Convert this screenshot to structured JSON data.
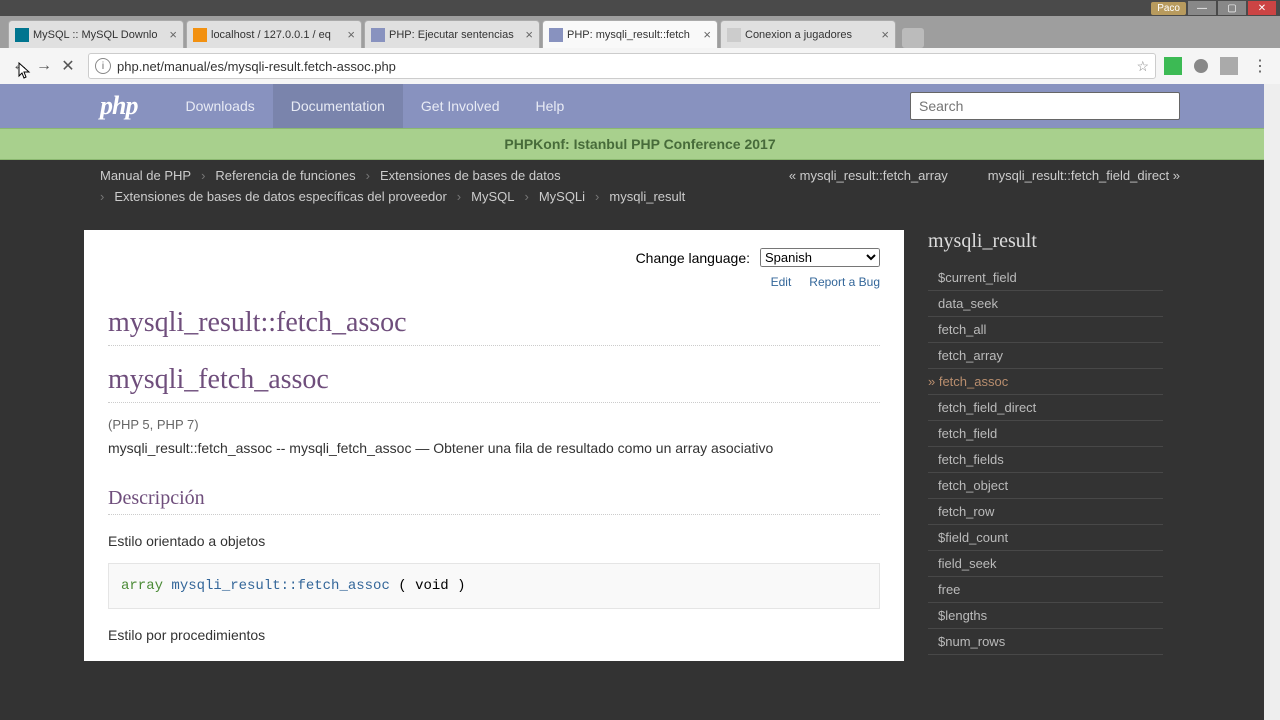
{
  "browser": {
    "user": "Paco",
    "url": "php.net/manual/es/mysqli-result.fetch-assoc.php",
    "tabs": [
      {
        "label": "MySQL :: MySQL Downlo"
      },
      {
        "label": "localhost / 127.0.0.1 / eq"
      },
      {
        "label": "PHP: Ejecutar sentencias"
      },
      {
        "label": "PHP: mysqli_result::fetch"
      },
      {
        "label": "Conexion a jugadores"
      }
    ]
  },
  "php_nav": {
    "logo": "php",
    "items": [
      "Downloads",
      "Documentation",
      "Get Involved",
      "Help"
    ],
    "search_placeholder": "Search"
  },
  "banner": "PHPKonf: Istanbul PHP Conference 2017",
  "crumbs": {
    "row1": [
      "Manual de PHP",
      "Referencia de funciones",
      "Extensiones de bases de datos"
    ],
    "row2": [
      "Extensiones de bases de datos específicas del proveedor",
      "MySQL",
      "MySQLi",
      "mysqli_result"
    ],
    "prev": "« mysqli_result::fetch_array",
    "next": "mysqli_result::fetch_field_direct »"
  },
  "lang": {
    "label": "Change language:",
    "value": "Spanish",
    "edit": "Edit",
    "report": "Report a Bug"
  },
  "content": {
    "h1a": "mysqli_result::fetch_assoc",
    "h1b": "mysqli_fetch_assoc",
    "versions": "(PHP 5, PHP 7)",
    "summary": "mysqli_result::fetch_assoc -- mysqli_fetch_assoc — Obtener una fila de resultado como un array asociativo",
    "desc_heading": "Descripción",
    "style_oo": "Estilo orientado a objetos",
    "code_oo_type": "array",
    "code_oo_method": "mysqli_result::fetch_assoc",
    "code_oo_rest": " ( void )",
    "style_proc": "Estilo por procedimientos"
  },
  "sidebar": {
    "title": "mysqli_result",
    "items": [
      "$current_field",
      "data_seek",
      "fetch_all",
      "fetch_array",
      "fetch_assoc",
      "fetch_field_direct",
      "fetch_field",
      "fetch_fields",
      "fetch_object",
      "fetch_row",
      "$field_count",
      "field_seek",
      "free",
      "$lengths",
      "$num_rows"
    ],
    "current": "fetch_assoc"
  }
}
